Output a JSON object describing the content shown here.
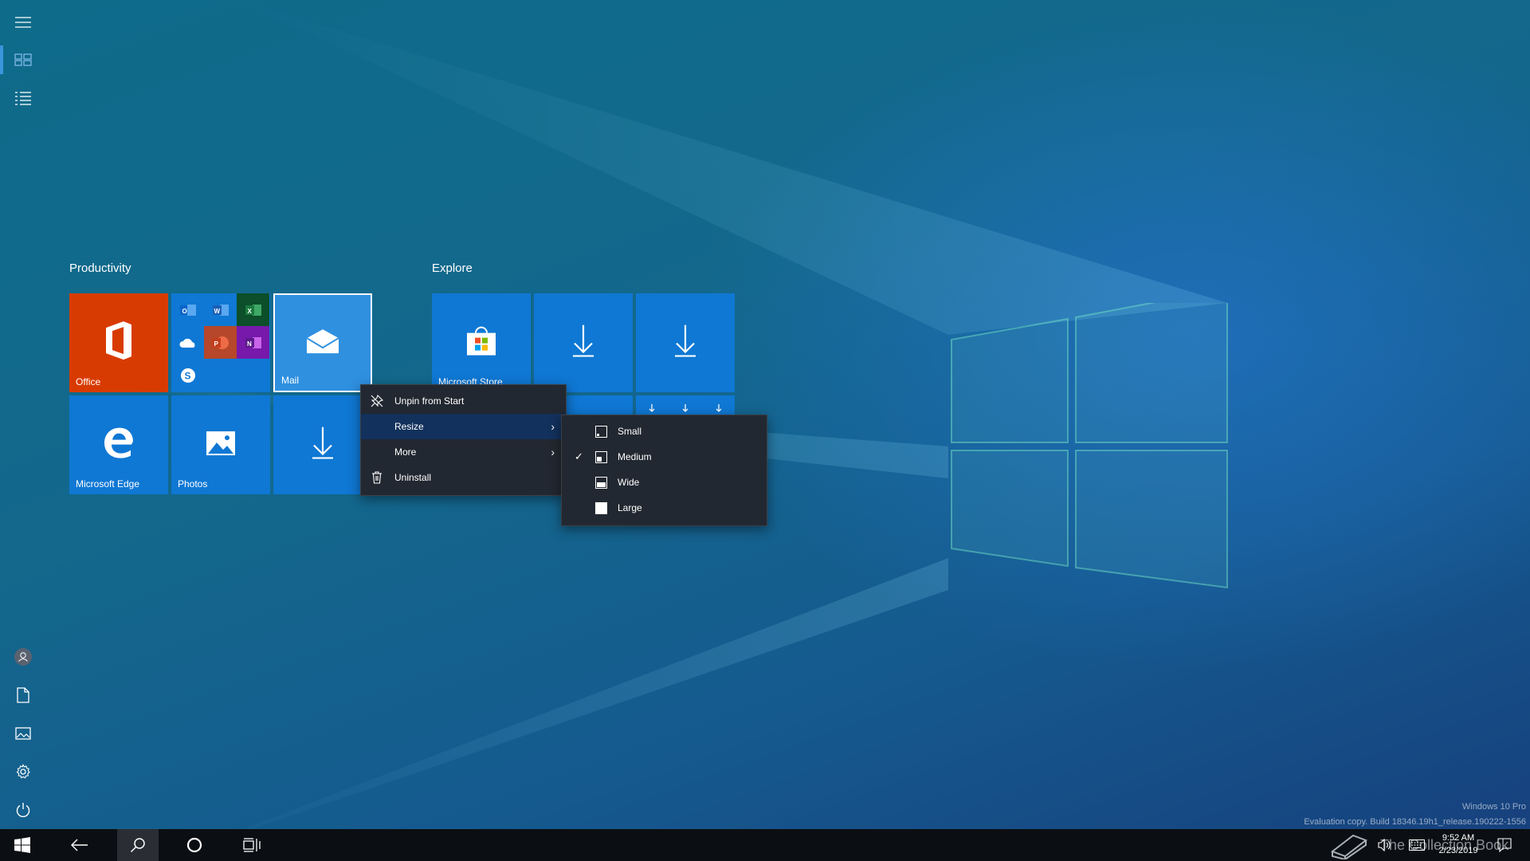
{
  "start": {
    "groups": [
      {
        "title": "Productivity"
      },
      {
        "title": "Explore"
      }
    ],
    "tiles": {
      "office": {
        "label": "Office"
      },
      "mail": {
        "label": "Mail"
      },
      "edge": {
        "label": "Microsoft Edge"
      },
      "photos": {
        "label": "Photos"
      },
      "store": {
        "label": "Microsoft Store"
      }
    },
    "office_apps": [
      "Outlook",
      "Word",
      "Excel",
      "OneDrive",
      "PowerPoint",
      "OneNote",
      "Skype"
    ]
  },
  "context_menu": {
    "items": [
      {
        "label": "Unpin from Start",
        "icon": "unpin-icon"
      },
      {
        "label": "Resize",
        "icon": "",
        "submenu": true,
        "highlight": true
      },
      {
        "label": "More",
        "icon": "",
        "submenu": true
      },
      {
        "label": "Uninstall",
        "icon": "trash-icon"
      }
    ]
  },
  "resize_menu": {
    "items": [
      {
        "label": "Small",
        "checked": false
      },
      {
        "label": "Medium",
        "checked": true
      },
      {
        "label": "Wide",
        "checked": false
      },
      {
        "label": "Large",
        "checked": false
      }
    ]
  },
  "taskbar": {
    "clock_time": "9:52 AM",
    "clock_date": "2/23/2019"
  },
  "watermark": {
    "edition": "Windows 10 Pro",
    "build": "Evaluation copy. Build 18346.19h1_release.190222-1556",
    "collection": "The Collection Book"
  },
  "colors": {
    "tile_blue": "#0f78d4",
    "office_orange": "#d83b01",
    "menu_bg": "#222831",
    "menu_highlight": "#12315c"
  }
}
